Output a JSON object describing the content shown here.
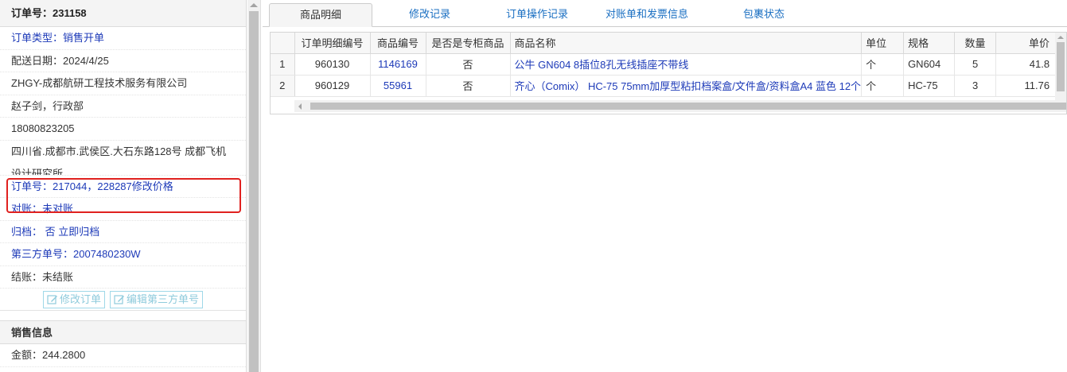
{
  "order_panel": {
    "header": "订单号：231158",
    "order_type": "订单类型：销售开单",
    "delivery_date": "配送日期：2024/4/25",
    "company": "ZHGY-成都航研工程技术服务有限公司",
    "contact": "赵子剑，行政部",
    "phone": "18080823205",
    "address_line1": "四川省.成都市.武侯区.大石东路128号 成都飞机",
    "address_line2": "设计研究所",
    "related_orders": "订单号：217044，228287修改价格",
    "reconcile": "对账：未对账",
    "archive_label": "归档：",
    "archive_value": "否",
    "archive_link": "立即归档",
    "third_party_no": "第三方单号：2007480230W",
    "settlement": "结账：未结账",
    "edit_order_btn": "修改订单",
    "edit_third_btn": "编辑第三方单号"
  },
  "sales_info": {
    "title": "销售信息",
    "amount": "金额：244.2800"
  },
  "tabs": [
    {
      "label": "商品明细",
      "active": true
    },
    {
      "label": "修改记录",
      "active": false
    },
    {
      "label": "订单操作记录",
      "active": false
    },
    {
      "label": "对账单和发票信息",
      "active": false
    },
    {
      "label": "包裹状态",
      "active": false
    }
  ],
  "grid": {
    "columns": [
      "订单明细编号",
      "商品编号",
      "是否是专柜商品",
      "商品名称",
      "单位",
      "规格",
      "数量",
      "单价"
    ],
    "rows": [
      {
        "rn": "1",
        "detail_no": "960130",
        "product_no": "1146169",
        "counter": "否",
        "name": "公牛 GN604 8插位8孔无线插座不带线",
        "unit": "个",
        "spec": "GN604",
        "qty": "5",
        "price": "41.8"
      },
      {
        "rn": "2",
        "detail_no": "960129",
        "product_no": "55961",
        "counter": "否",
        "name": "齐心（Comix） HC-75 75mm加厚型粘扣档案盒/文件盒/资料盒A4 蓝色 12个",
        "unit": "个",
        "spec": "HC-75",
        "qty": "3",
        "price": "11.76"
      }
    ]
  },
  "colors": {
    "link": "#1d3ab8",
    "tab_link": "#1a6fc2",
    "highlight": "#e0211f",
    "button": "#8fcbdc"
  }
}
